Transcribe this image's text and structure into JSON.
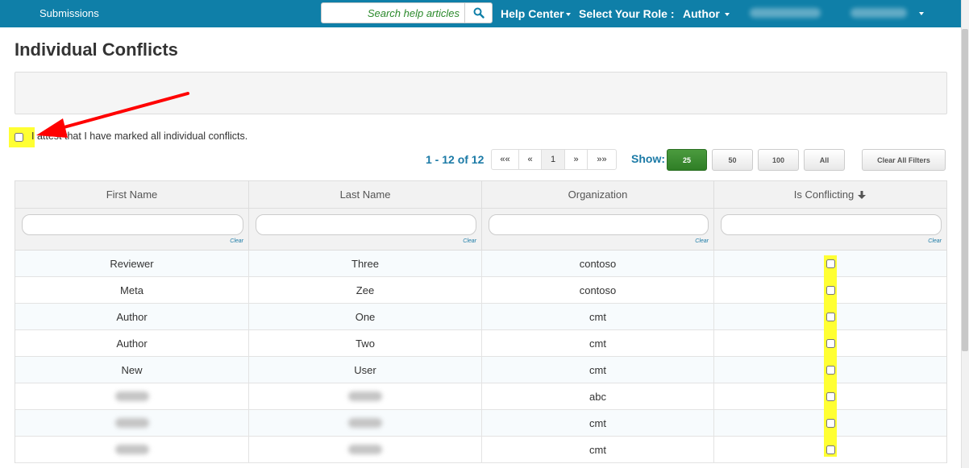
{
  "topbar": {
    "link": "Submissions",
    "search_placeholder": "Search help articles",
    "help_center": "Help Center",
    "select_role_label": "Select Your Role :",
    "role_value": "Author"
  },
  "page": {
    "title": "Individual Conflicts",
    "attest_label": "I attest that I have marked all individual conflicts."
  },
  "pager": {
    "count": "1 - 12 of 12",
    "first": "««",
    "prev": "«",
    "current": "1",
    "next": "»",
    "last": "»»",
    "show_label": "Show:",
    "sizes": [
      "25",
      "50",
      "100",
      "All"
    ],
    "active_size": "25",
    "clear_all": "Clear All Filters"
  },
  "table": {
    "headers": [
      "First Name",
      "Last Name",
      "Organization",
      "Is Conflicting"
    ],
    "sort_icon": "arrow-down-icon",
    "filter_clear": "Clear",
    "rows": [
      {
        "first": "Reviewer",
        "last": "Three",
        "org": "contoso"
      },
      {
        "first": "Meta",
        "last": "Zee",
        "org": "contoso"
      },
      {
        "first": "Author",
        "last": "One",
        "org": "cmt"
      },
      {
        "first": "Author",
        "last": "Two",
        "org": "cmt"
      },
      {
        "first": "New",
        "last": "User",
        "org": "cmt"
      },
      {
        "first": "",
        "last": "",
        "org": "abc"
      },
      {
        "first": "",
        "last": "",
        "org": "cmt"
      },
      {
        "first": "",
        "last": "",
        "org": "cmt"
      }
    ]
  },
  "colors": {
    "topbar": "#0f7fa8",
    "highlight": "#ffff33",
    "arrow": "#ff0000",
    "active_size": "#3a8c30",
    "link_blue": "#1b7aa6"
  }
}
